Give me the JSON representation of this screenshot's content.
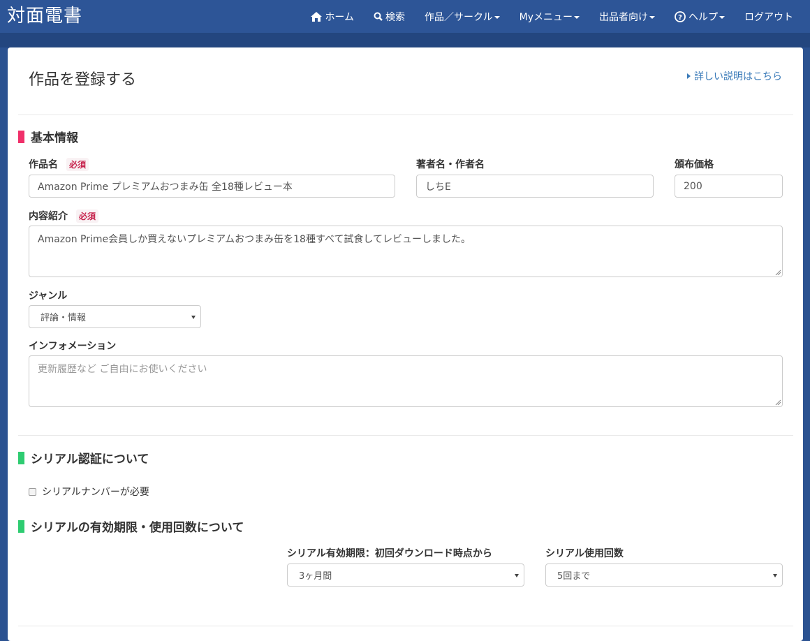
{
  "logo": "対面電書",
  "nav": {
    "home": "ホーム",
    "search": "検索",
    "works": "作品／サークル",
    "mymenu": "Myメニュー",
    "sellers": "出品者向け",
    "help": "ヘルプ",
    "logout": "ログアウト"
  },
  "page": {
    "title": "作品を登録する",
    "help_link": "詳しい説明はこちら"
  },
  "basic": {
    "section_title": "基本情報",
    "required_badge": "必須",
    "title_label": "作品名",
    "title_value": "Amazon Prime  プレミアムおつまみ缶 全18種レビュー本",
    "author_label": "著者名・作者名",
    "author_value": "しちE",
    "price_label": "頒布価格",
    "price_value": "200",
    "description_label": "内容紹介",
    "description_value": "Amazon Prime会員しか買えないプレミアムおつまみ缶を18種すべて試食してレビューしました。",
    "genre_label": "ジャンル",
    "genre_value": "評論・情報",
    "info_label": "インフォメーション",
    "info_placeholder": "更新履歴など ご自由にお使いください"
  },
  "serial": {
    "section_title": "シリアル認証について",
    "checkbox_label": "シリアルナンバーが必要"
  },
  "serial_limit": {
    "section_title": "シリアルの有効期限・使用回数について",
    "expiry_label": "シリアル有効期限：初回ダウンロード時点から",
    "expiry_value": "3ヶ月間",
    "uses_label": "シリアル使用回数",
    "uses_value": "5回まで"
  },
  "colors": {
    "navbar": "#2d5597",
    "basic_accent": "#f0306a",
    "serial_accent": "#2ecc71"
  }
}
